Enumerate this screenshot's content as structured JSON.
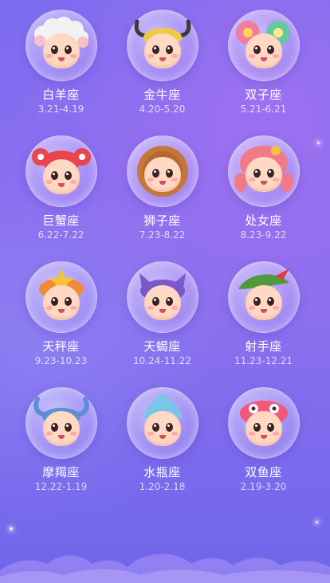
{
  "signs": [
    {
      "name": "白羊座",
      "dates": "3.21-4.19",
      "icon": "aries-icon",
      "color": "#f2f2f2",
      "accent": "#ffffff"
    },
    {
      "name": "金牛座",
      "dates": "4.20-5.20",
      "icon": "taurus-icon",
      "color": "#f2c84b",
      "accent": "#3b3b3b"
    },
    {
      "name": "双子座",
      "dates": "5.21-6.21",
      "icon": "gemini-icon",
      "color": "#f07ea0",
      "accent": "#63c9a0"
    },
    {
      "name": "巨蟹座",
      "dates": "6.22-7.22",
      "icon": "cancer-icon",
      "color": "#e8454d",
      "accent": "#e8454d"
    },
    {
      "name": "狮子座",
      "dates": "7.23-8.22",
      "icon": "leo-icon",
      "color": "#c4773a",
      "accent": "#a45b2a"
    },
    {
      "name": "处女座",
      "dates": "8.23-9.22",
      "icon": "virgo-icon",
      "color": "#f07a86",
      "accent": "#f4c23d"
    },
    {
      "name": "天秤座",
      "dates": "9.23-10.23",
      "icon": "libra-icon",
      "color": "#f2893b",
      "accent": "#f5c33a"
    },
    {
      "name": "天蝎座",
      "dates": "10.24-11.22",
      "icon": "scorpio-icon",
      "color": "#7b57c8",
      "accent": "#6a45b8"
    },
    {
      "name": "射手座",
      "dates": "11.23-12.21",
      "icon": "sagittarius-icon",
      "color": "#4e9a3c",
      "accent": "#e03a3a"
    },
    {
      "name": "摩羯座",
      "dates": "12.22-1.19",
      "icon": "capricorn-icon",
      "color": "#5b8fd6",
      "accent": "#ffffff"
    },
    {
      "name": "水瓶座",
      "dates": "1.20-2.18",
      "icon": "aquarius-icon",
      "color": "#79c6e8",
      "accent": "#6b8f2e"
    },
    {
      "name": "双鱼座",
      "dates": "2.19-3.20",
      "icon": "pisces-icon",
      "color": "#f2587a",
      "accent": "#ffffff"
    }
  ]
}
